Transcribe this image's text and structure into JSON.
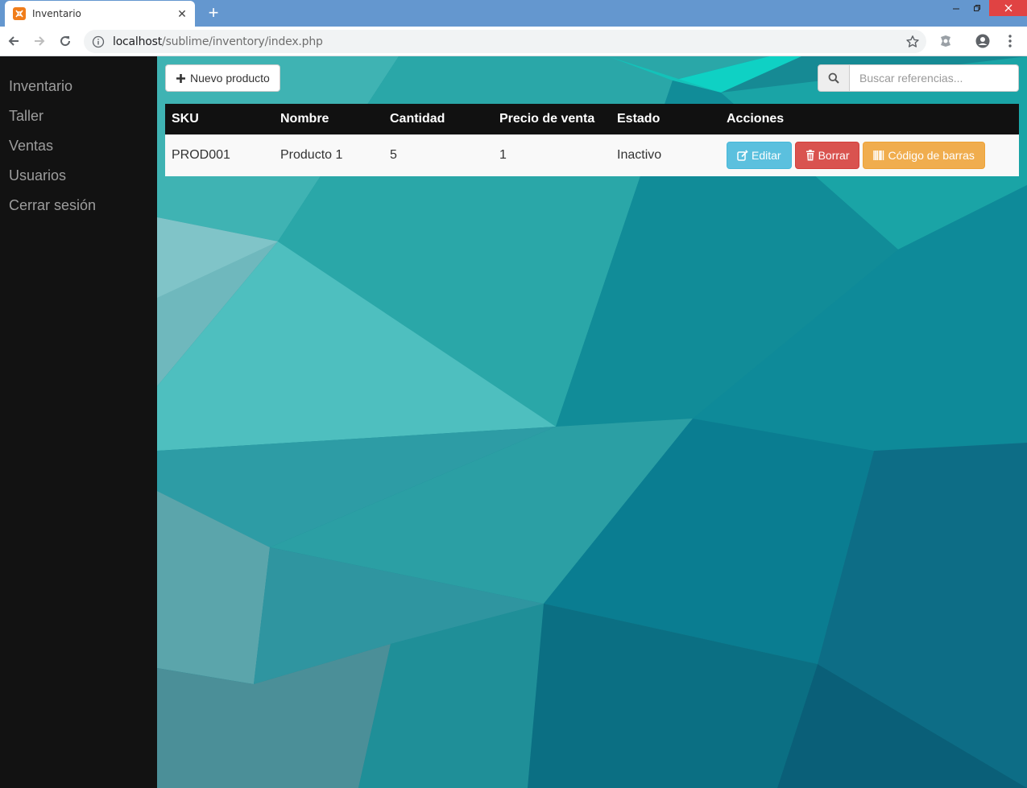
{
  "browser": {
    "tab_title": "Inventario",
    "url_host": "localhost",
    "url_path": "/sublime/inventory/index.php",
    "favicon_color": "#f07d1a",
    "titlebar_color": "#6497cf"
  },
  "sidebar": {
    "items": [
      {
        "label": "Inventario"
      },
      {
        "label": "Taller"
      },
      {
        "label": "Ventas"
      },
      {
        "label": "Usuarios"
      },
      {
        "label": "Cerrar sesión"
      }
    ]
  },
  "main": {
    "new_product_label": "Nuevo producto",
    "search_placeholder": "Buscar referencias...",
    "table": {
      "headers": [
        "SKU",
        "Nombre",
        "Cantidad",
        "Precio de venta",
        "Estado",
        "Acciones"
      ],
      "rows": [
        {
          "sku": "PROD001",
          "nombre": "Producto 1",
          "cantidad": "5",
          "precio": "1",
          "estado": "Inactivo",
          "actions": {
            "edit_label": "Editar",
            "delete_label": "Borrar",
            "barcode_label": "Código de barras"
          }
        }
      ]
    }
  },
  "colors": {
    "sidebar_bg": "#121212",
    "table_header_bg": "#111111",
    "edit": "#5bc0de",
    "delete": "#d9534f",
    "barcode": "#f0ad4e"
  }
}
